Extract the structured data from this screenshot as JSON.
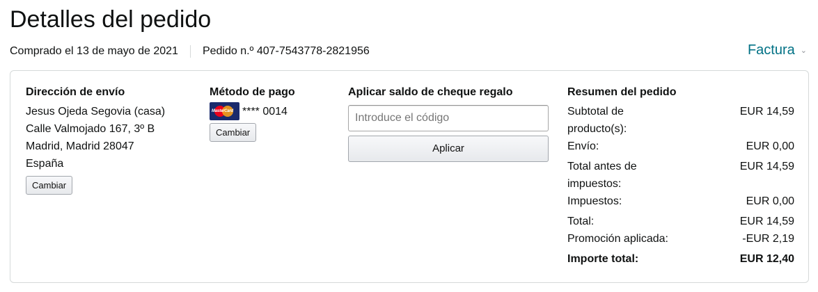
{
  "header": {
    "title": "Detalles del pedido",
    "purchase_date": "Comprado el 13 de mayo de 2021",
    "order_number": "Pedido n.º 407-7543778-2821956",
    "invoice_label": "Factura"
  },
  "shipping": {
    "heading": "Dirección de envío",
    "lines": [
      "Jesus Ojeda Segovia (casa)",
      "Calle Valmojado 167, 3º B",
      "Madrid, Madrid 28047",
      "España"
    ],
    "change_label": "Cambiar"
  },
  "payment": {
    "heading": "Método de pago",
    "card_icon": "mastercard-icon",
    "card_brand_text": "MasterCard",
    "card_number": "**** 0014",
    "change_label": "Cambiar"
  },
  "gift": {
    "heading": "Aplicar saldo de cheque regalo",
    "placeholder": "Introduce el código",
    "value": "",
    "apply_label": "Aplicar"
  },
  "summary": {
    "heading": "Resumen del pedido",
    "rows": [
      {
        "label": "Subtotal de producto(s):",
        "value": "EUR 14,59"
      },
      {
        "label": "Envío:",
        "value": "EUR 0,00"
      },
      {
        "label": "Total antes de impuestos:",
        "value": "EUR 14,59"
      },
      {
        "label": "Impuestos:",
        "value": "EUR 0,00"
      },
      {
        "label": "Total:",
        "value": "EUR 14,59"
      },
      {
        "label": "Promoción aplicada:",
        "value": "-EUR 2,19"
      }
    ],
    "grand_total": {
      "label": "Importe total:",
      "value": "EUR 12,40"
    }
  },
  "colors": {
    "link": "#007185",
    "text": "#0f1111",
    "border": "#d5d9d9"
  }
}
